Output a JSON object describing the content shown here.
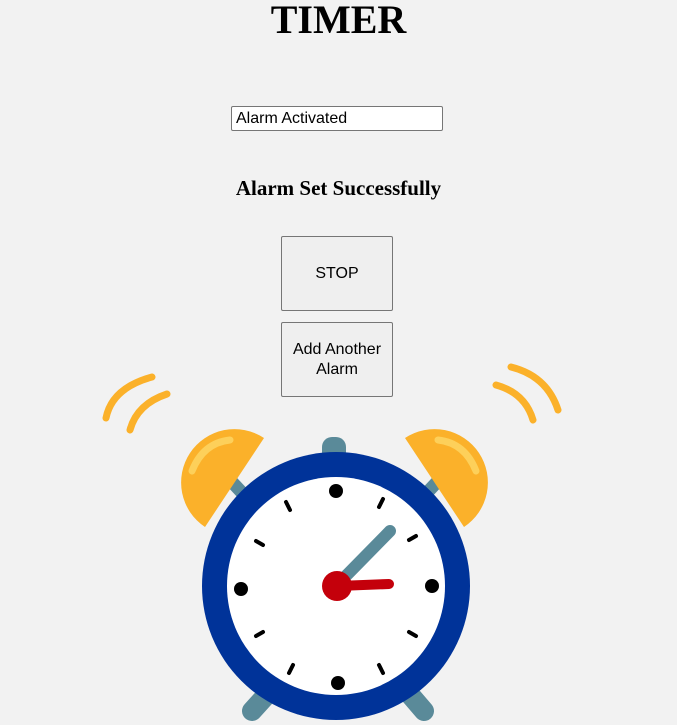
{
  "header": {
    "title": "TIMER"
  },
  "status_input": {
    "value": "Alarm Activated"
  },
  "message": {
    "text": "Alarm Set Successfully"
  },
  "buttons": {
    "stop_label": "STOP",
    "add_label": "Add Another Alarm"
  },
  "illustration": {
    "icon": "alarm-clock-icon",
    "colors": {
      "frame": "#003399",
      "bells": "#fbb12a",
      "legs": "#5a8a99",
      "minute_hand": "#5a8a99",
      "hour_hand": "#c4000b",
      "face": "#ffffff"
    }
  }
}
